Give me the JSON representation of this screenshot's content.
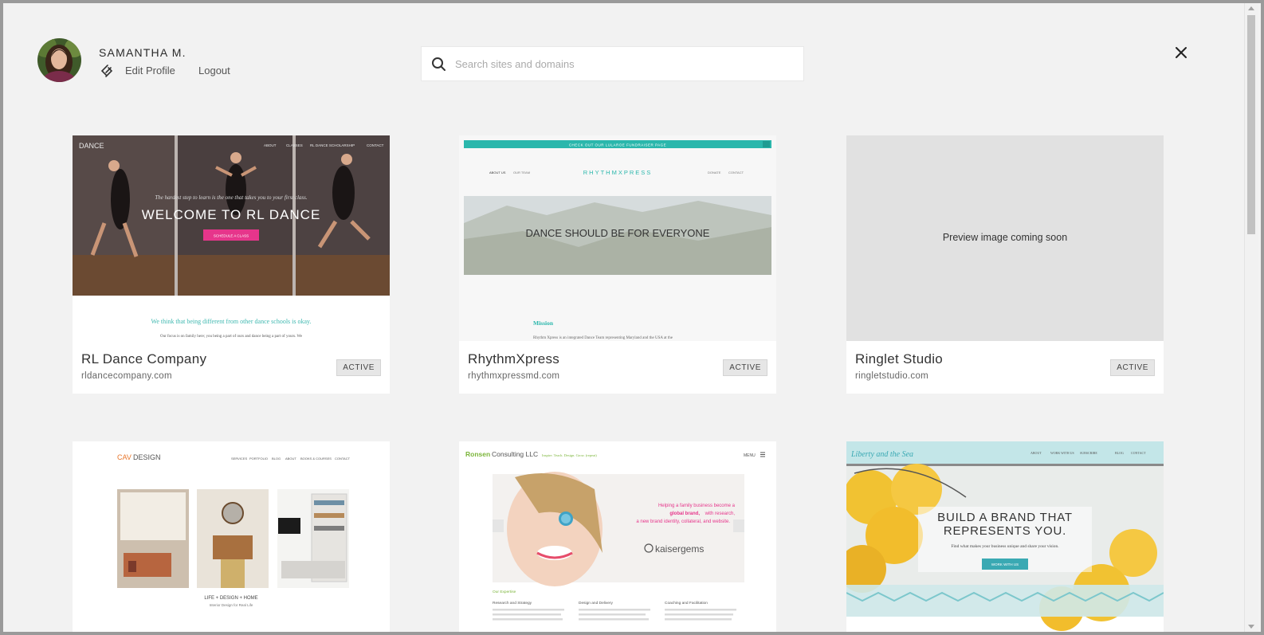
{
  "user": {
    "name": "SAMANTHA M.",
    "edit_profile_label": "Edit Profile",
    "logout_label": "Logout"
  },
  "search": {
    "placeholder": "Search sites and domains",
    "value": ""
  },
  "colors": {
    "page_background": "#f2f2f2",
    "card_background": "#ffffff",
    "badge_background": "#e6e6e6"
  },
  "sites": [
    {
      "title": "RL Dance Company",
      "domain": "rldancecompany.com",
      "status": "ACTIVE",
      "preview": {
        "logo": "DANCE",
        "nav": [
          "ABOUT",
          "CLASSES",
          "RL DANCE SCHOLARSHIP",
          "CONTACT"
        ],
        "tagline": "The hardest step to learn is the one that takes you to your first class.",
        "headline": "WELCOME TO RL DANCE",
        "cta": "SCHEDULE A CLASS",
        "subheading": "We think that being different from other dance schools is okay.",
        "body": "Our focus is on family here; you being a part of ours and dance being a part of yours. We"
      }
    },
    {
      "title": "RhythmXpress",
      "domain": "rhythmxpressmd.com",
      "status": "ACTIVE",
      "preview": {
        "banner": "CHECK OUT OUR LULAROE FUNDRAISER PAGE",
        "nav_left": [
          "ABOUT US",
          "OUR TEAM"
        ],
        "logo": "RHYTHMXPRESS",
        "nav_right": [
          "DONATE",
          "CONTACT"
        ],
        "headline": "DANCE SHOULD BE FOR EVERYONE",
        "section": "Mission",
        "body": "Rhythm Xpress is an integrated Dance Team representing Maryland and the USA at the"
      }
    },
    {
      "title": "Ringlet Studio",
      "domain": "ringletstudio.com",
      "status": "ACTIVE",
      "preview": {
        "placeholder_text": "Preview image coming soon"
      }
    },
    {
      "title": "CAV Design",
      "preview": {
        "logo_a": "CAV",
        "logo_b": "DESIGN",
        "nav": [
          "SERVICES",
          "PORTFOLIO",
          "BLOG",
          "ABOUT",
          "BOOKS & COURSES",
          "CONTACT"
        ],
        "caption": "LIFE + DESIGN + HOME",
        "subcaption": "Interior Design for Real Life"
      }
    },
    {
      "title": "Ronsen Consulting LLC",
      "preview": {
        "logo_a": "Ronsen",
        "logo_b": "Consulting LLC",
        "tagline": "Inspire. Teach. Design. Grow. (repeat)",
        "menu": "MENU",
        "promo_1": "Helping a family business become a",
        "promo_2": "global brand,",
        "promo_2b": "with research,",
        "promo_3": "a new brand identity, collateral, and website.",
        "brand": "kaisergems",
        "section": "Our Expertise",
        "columns": [
          "Research and Strategy",
          "Design and Delivery",
          "Coaching and Facilitation"
        ]
      }
    },
    {
      "title": "Liberty and the Sea",
      "preview": {
        "logo": "Liberty and the Sea",
        "nav": [
          "ABOUT",
          "WORK WITH US",
          "SUBSCRIBE",
          "BLOG",
          "CONTACT"
        ],
        "headline_1": "BUILD A BRAND THAT",
        "headline_2": "REPRESENTS YOU.",
        "tagline": "Find what makes your business unique and share your vision.",
        "cta": "WORK WITH US"
      }
    }
  ]
}
